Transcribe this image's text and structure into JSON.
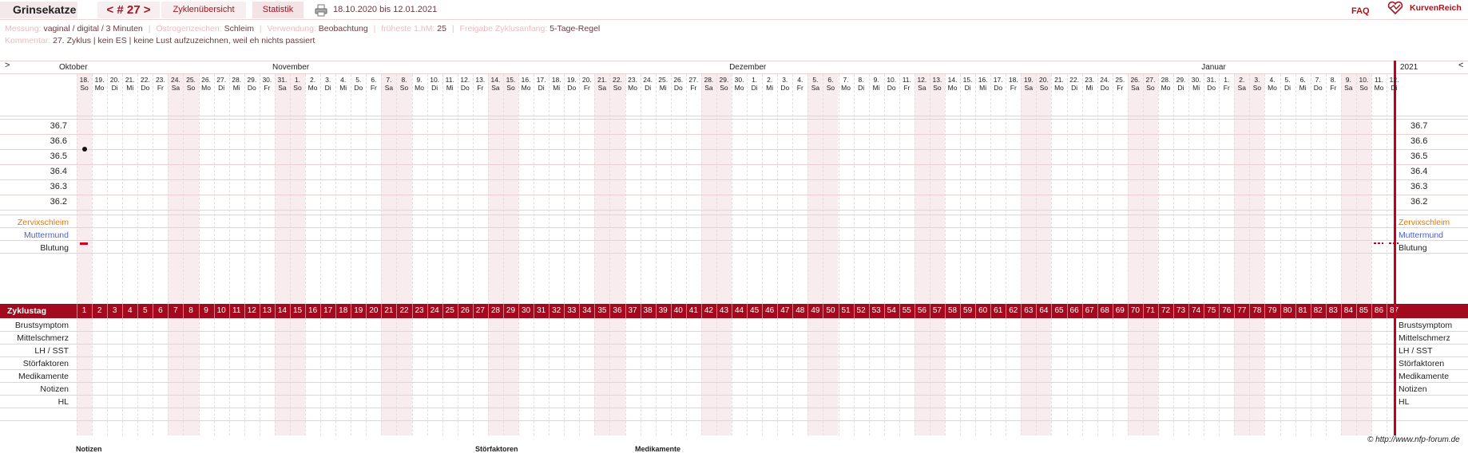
{
  "header": {
    "user": "Grinsekatze",
    "cycle_nav": "< # 27 >",
    "tab_overview": "Zyklenübersicht",
    "tab_stats": "Statistik",
    "range": "18.10.2020 bis 12.01.2021",
    "faq": "FAQ",
    "logo": "KurvenReich"
  },
  "info": {
    "messung_k": "Messung:",
    "messung_v": "vaginal / digital / 3 Minuten",
    "oestrogen_k": "Östrogenzeichen:",
    "oestrogen_v": "Schleim",
    "verwendung_k": "Verwendung:",
    "verwendung_v": "Beobachtung",
    "fruehest_k": "früheste 1.hM:",
    "fruehest_v": "25",
    "freigabe_k": "Freigabe Zyklusanfang:",
    "freigabe_v": "5-Tage-Regel",
    "kommentar_k": "Kommentar:",
    "kommentar_v": "27. Zyklus | kein ES | keine Lust aufzuzeichnen, weil eh nichts passiert"
  },
  "nav": {
    "left": ">",
    "right": "<",
    "year": "2021"
  },
  "months": [
    {
      "label": "Oktober",
      "day": 1
    },
    {
      "label": "November",
      "day": 15
    },
    {
      "label": "Dezember",
      "day": 45
    },
    {
      "label": "Januar",
      "day": 76
    }
  ],
  "days": {
    "dates": [
      "18.",
      "19.",
      "20.",
      "21.",
      "22.",
      "23.",
      "24.",
      "25.",
      "26.",
      "27.",
      "28.",
      "29.",
      "30.",
      "31.",
      "1.",
      "2.",
      "3.",
      "4.",
      "5.",
      "6.",
      "7.",
      "8.",
      "9.",
      "10.",
      "11.",
      "12.",
      "13.",
      "14.",
      "15.",
      "16.",
      "17.",
      "18.",
      "19.",
      "20.",
      "21.",
      "22.",
      "23.",
      "24.",
      "25.",
      "26.",
      "27.",
      "28.",
      "29.",
      "30.",
      "1.",
      "2.",
      "3.",
      "4.",
      "5.",
      "6.",
      "7.",
      "8.",
      "9.",
      "10.",
      "11.",
      "12.",
      "13.",
      "14.",
      "15.",
      "16.",
      "17.",
      "18.",
      "19.",
      "20.",
      "21.",
      "22.",
      "23.",
      "24.",
      "25.",
      "26.",
      "27.",
      "28.",
      "29.",
      "30.",
      "31.",
      "1.",
      "2.",
      "3.",
      "4.",
      "5.",
      "6.",
      "7.",
      "8.",
      "9.",
      "10.",
      "11.",
      "12."
    ],
    "weekdays": [
      "So",
      "Mo",
      "Di",
      "Mi",
      "Do",
      "Fr",
      "Sa"
    ]
  },
  "temperature": {
    "scale": [
      "36.7",
      "36.6",
      "36.5",
      "36.4",
      "36.3",
      "36.2"
    ],
    "points": [
      {
        "day": 1,
        "value": 36.55
      }
    ]
  },
  "rows_top": {
    "zervix": "Zervixschleim",
    "muttermund": "Muttermund",
    "blutung": "Blutung"
  },
  "zyklus_label": "Zyklustag",
  "bleeding_days": [
    1,
    86,
    87
  ],
  "rows_bottom": [
    "Brustsymptom",
    "Mittelschmerz",
    "LH / SST",
    "Störfaktoren",
    "Medikamente",
    "Notizen",
    "HL"
  ],
  "footer": {
    "copyright": "© http://www.nfp-forum.de",
    "notizen": "Notizen",
    "stoerfaktoren": "Störfaktoren",
    "medikamente": "Medikamente"
  },
  "colors": {
    "accent": "#a30a1d",
    "weekend": "#f8ecee",
    "zervix": "#e07a00",
    "muttermund": "#4a5fd0"
  }
}
